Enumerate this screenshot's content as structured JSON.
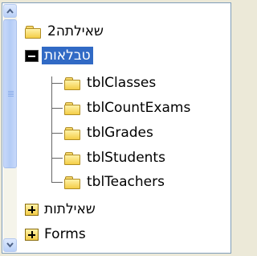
{
  "tree": {
    "nodes": [
      {
        "label": "שאילתה2",
        "kind": "folder",
        "dir": "rtl"
      },
      {
        "label": "טבלאות",
        "kind": "expanded",
        "dir": "rtl",
        "selected": true
      },
      {
        "label": "tblClasses",
        "kind": "folder",
        "dir": "ltr"
      },
      {
        "label": "tblCountExams",
        "kind": "folder",
        "dir": "ltr"
      },
      {
        "label": "tblGrades",
        "kind": "folder",
        "dir": "ltr"
      },
      {
        "label": "tblStudents",
        "kind": "folder",
        "dir": "ltr"
      },
      {
        "label": "tblTeachers",
        "kind": "folder",
        "dir": "ltr"
      },
      {
        "label": "שאילתות",
        "kind": "collapsed",
        "dir": "rtl"
      },
      {
        "label": "Forms",
        "kind": "collapsed",
        "dir": "ltr"
      }
    ]
  },
  "colors": {
    "selection": "#316ac5",
    "panel_border": "#7f9db9",
    "scrollbar": "#c7d8fa"
  },
  "icons": {
    "scroll_up": "chevron-up-icon",
    "scroll_down": "chevron-down-icon",
    "folder": "folder-icon",
    "expand": "plus-box-icon",
    "collapse": "minus-box-icon"
  }
}
